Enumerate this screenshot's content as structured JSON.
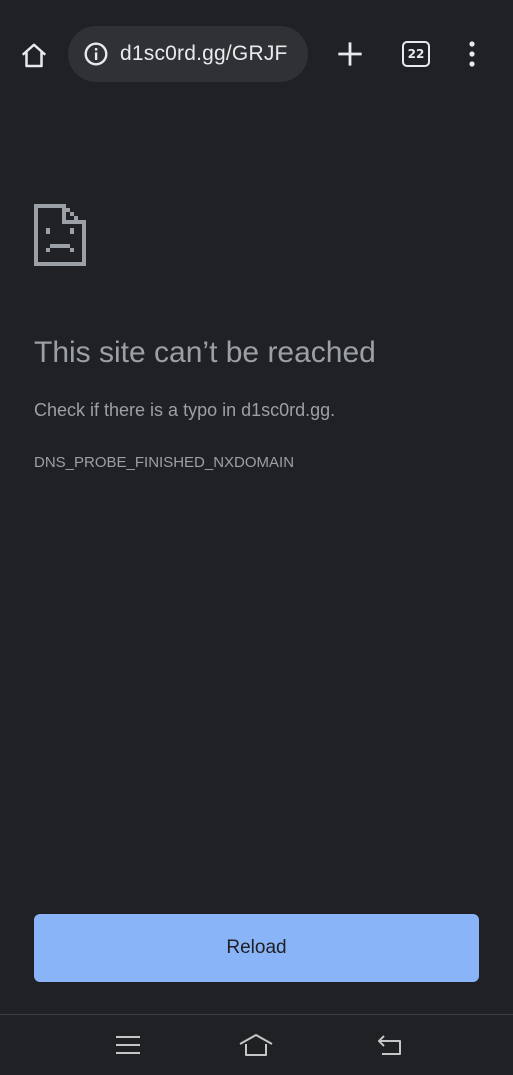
{
  "toolbar": {
    "url": "d1sc0rd.gg/GRJF",
    "tab_count": "22",
    "icons": {
      "home": "home-icon",
      "info": "info-icon",
      "new_tab": "plus-icon",
      "tabs": "tab-switcher-icon",
      "menu": "kebab-menu-icon"
    }
  },
  "error": {
    "icon": "sad-page-icon",
    "title": "This site can’t be reached",
    "message": "Check if there is a typo in d1sc0rd.gg.",
    "code": "DNS_PROBE_FINISHED_NXDOMAIN",
    "reload_label": "Reload"
  },
  "navbar": {
    "icons": [
      "menu-icon",
      "home-icon",
      "back-icon"
    ]
  },
  "colors": {
    "background": "#202124",
    "accent": "#8ab4f8",
    "text": "#9aa0a6"
  }
}
